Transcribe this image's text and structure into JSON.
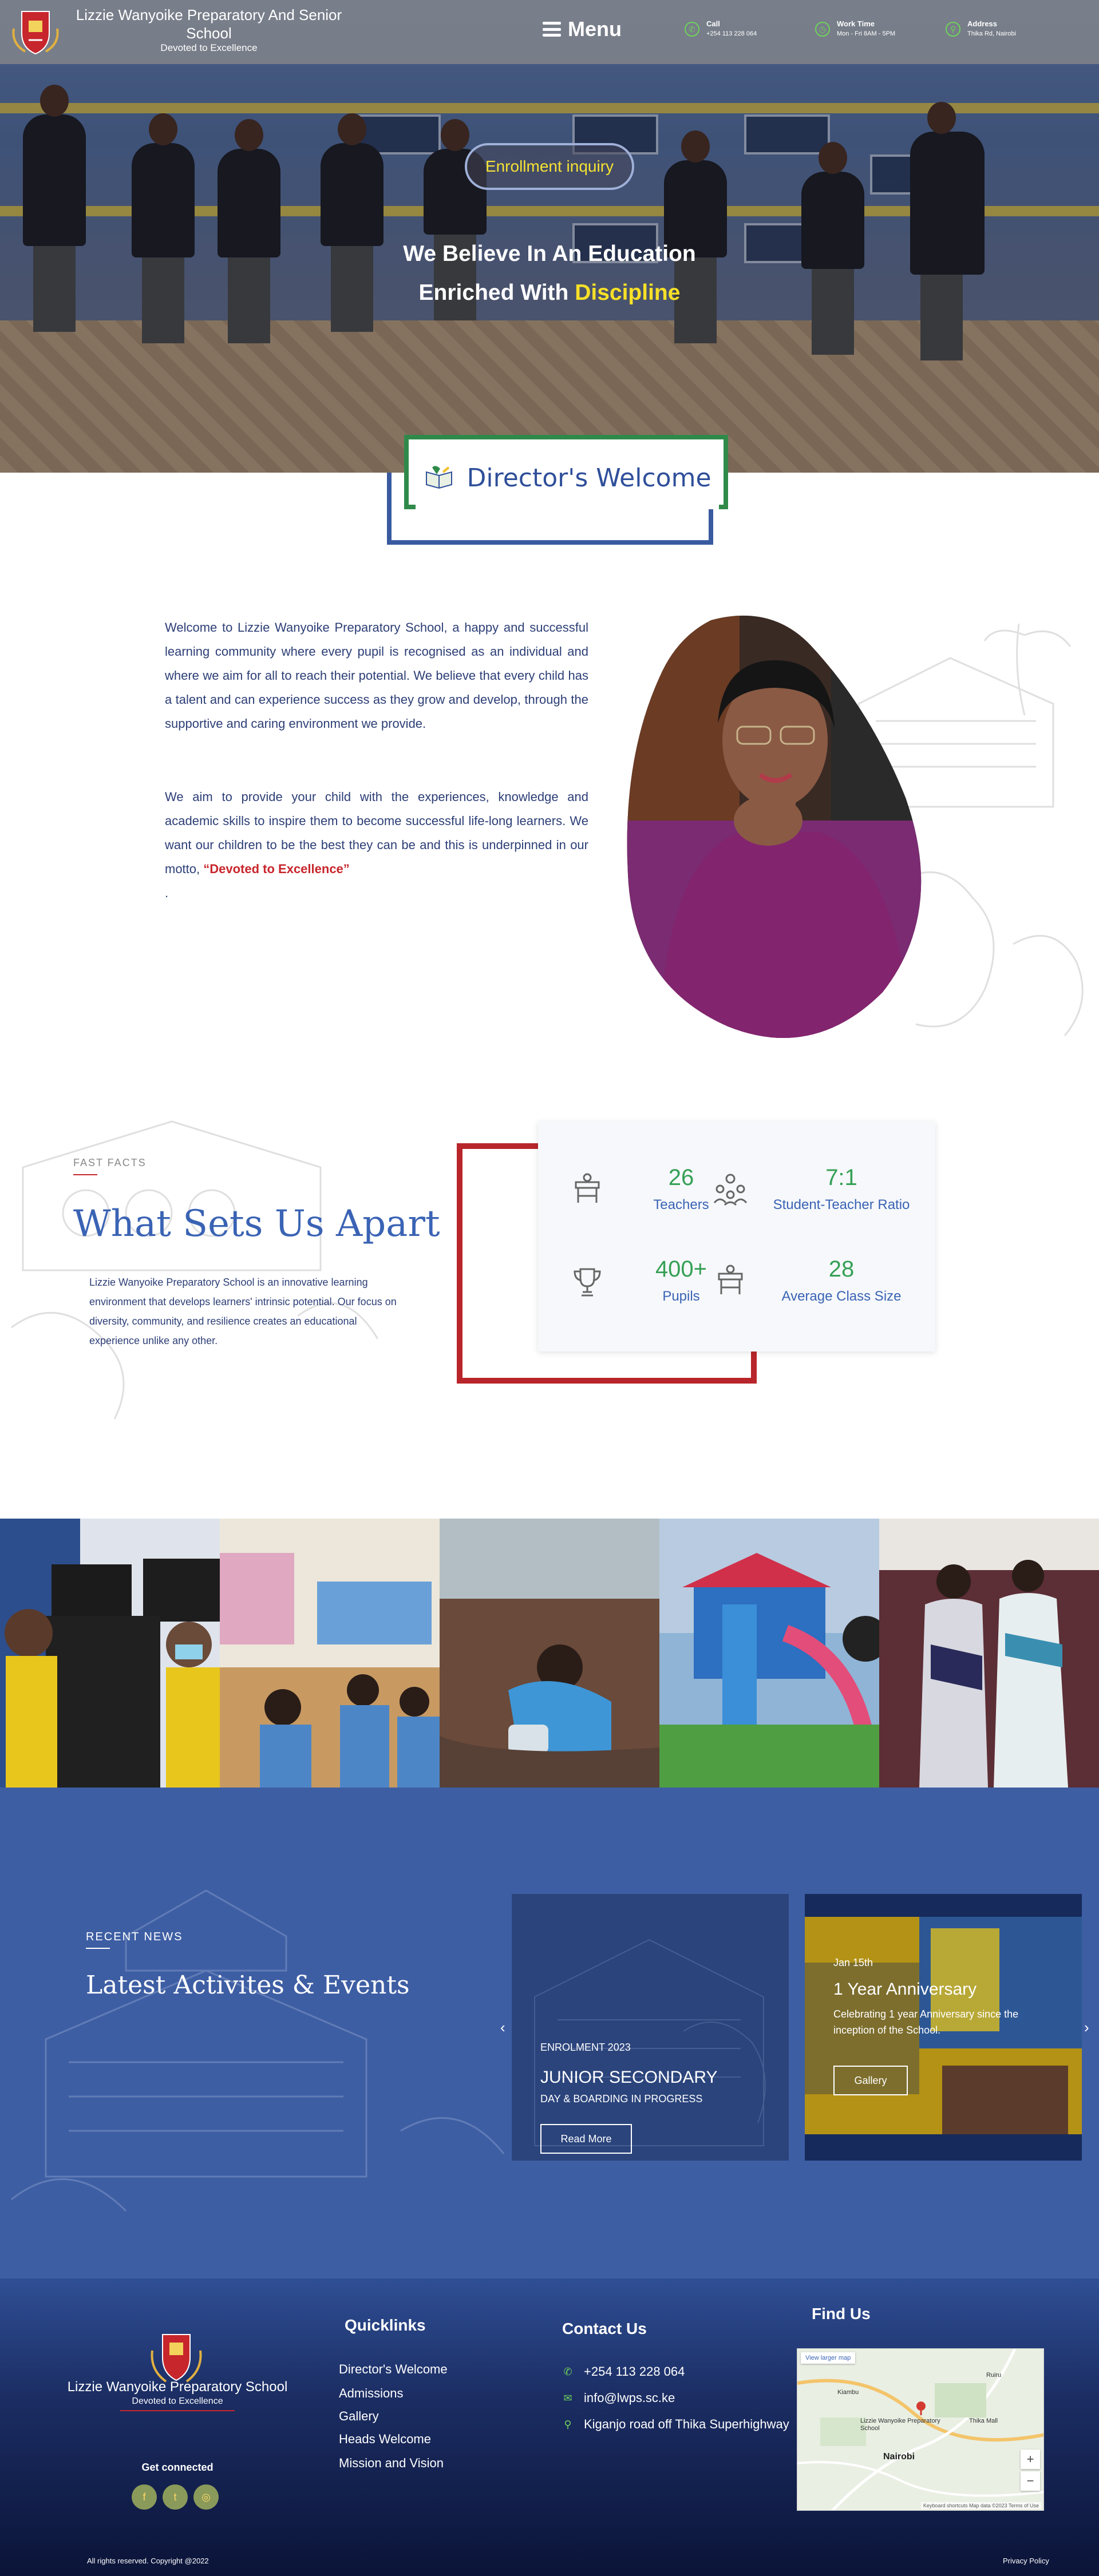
{
  "header": {
    "school_name": "Lizzie Wanyoike Preparatory And Senior School",
    "tagline": "Devoted to Excellence",
    "menu_label": "Menu",
    "call": {
      "label": "Call",
      "value": "+254 113 228 064"
    },
    "work_time": {
      "label": "Work Time",
      "value": "Mon - Fri 8AM - 5PM"
    },
    "address": {
      "label": "Address",
      "value": "Thika Rd, Nairobi"
    }
  },
  "hero": {
    "enroll_button": "Enrollment inquiry",
    "headline_line1": "We Believe In An Education",
    "headline_line2_prefix": "Enriched With ",
    "headline_highlight": "Discipline"
  },
  "director": {
    "title": "Director's Welcome",
    "paragraph1": "Welcome to Lizzie Wanyoike Preparatory School, a happy and successful learning community where every pupil is recognised as an individual and where we aim for all to reach their potential. We believe that every child has a talent and can experience success as they grow and develop, through the supportive and caring environment we provide.",
    "paragraph2_start": "We aim to provide your child with the experiences, knowledge and academic skills to inspire them to become successful life-long learners. We want our children to be the best they can be and this is underpinned in our motto, ",
    "motto": "“Devoted to Excellence”",
    "trailing": "."
  },
  "apart": {
    "label": "FAST FACTS",
    "title": "What Sets Us Apart",
    "description": "Lizzie Wanyoike Preparatory School is an innovative learning environment that develops learners' intrinsic potential. Our focus on diversity, community, and resilience creates an educational experience unlike any other.",
    "stats": [
      {
        "value": "26",
        "caption": "Teachers",
        "icon": "desk-icon"
      },
      {
        "value": "7:1",
        "caption": "Student-Teacher Ratio",
        "icon": "group-icon"
      },
      {
        "value": "400+",
        "caption": "Pupils",
        "icon": "trophy-icon"
      },
      {
        "value": "28",
        "caption": "Average Class Size",
        "icon": "desk-icon"
      }
    ]
  },
  "news": {
    "label": "RECENT NEWS",
    "title": "Latest Activites & Events",
    "cards": [
      {
        "kicker": "ENROLMENT 2023",
        "title": "JUNIOR SECONDARY",
        "subtitle": "DAY & BOARDING IN PROGRESS",
        "button": "Read More"
      },
      {
        "kicker": "Jan 15th",
        "title": "1 Year Anniversary",
        "subtitle": "Celebrating 1 year Anniversary since the inception of the School.",
        "button": "Gallery"
      }
    ]
  },
  "footer": {
    "school_name": "Lizzie Wanyoike Preparatory School",
    "motto": "Devoted to Excellence",
    "get_connected": "Get connected",
    "quicklinks_title": "Quicklinks",
    "quicklinks": [
      "Director's Welcome",
      "Admissions",
      "Gallery",
      "Heads Welcome",
      "Mission and Vision"
    ],
    "contact_title": "Contact Us",
    "phone": "+254 113 228 064",
    "email": "info@lwps.sc.ke",
    "address": "Kiganjo road off Thika Superhighway",
    "map_title": "Find Us",
    "map_button": "View larger map",
    "map_places": [
      "Lizzie Wanyoike Preparatory School",
      "Nairobi",
      "Ruiru",
      "Kiambu",
      "Thika Mall"
    ],
    "map_credits": "Keyboard shortcuts  Map data ©2023  Terms of Use",
    "copyright": "All rights reserved. Copyright @2022",
    "privacy": "Privacy Policy"
  },
  "colors": {
    "brand_blue": "#3a63b4",
    "accent_green": "#35a055",
    "accent_red": "#c8262d",
    "highlight_yellow": "#f7e027",
    "news_bg": "#3e5ea4"
  }
}
